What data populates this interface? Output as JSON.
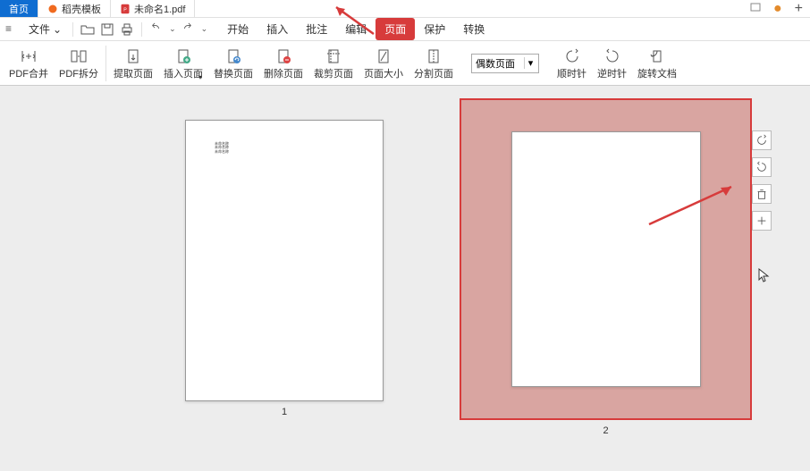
{
  "tabs": {
    "home": "首页",
    "template": "稻壳模板",
    "doc": "未命名1.pdf"
  },
  "menu": {
    "menuBtn": "≡",
    "fileLabel": "文件",
    "chevron": "⌄",
    "items": [
      "开始",
      "插入",
      "批注",
      "编辑",
      "页面",
      "保护",
      "转换"
    ],
    "activeIndex": 4
  },
  "ribbon": {
    "pdfMerge": "PDF合并",
    "pdfSplit": "PDF拆分",
    "extract": "提取页面",
    "insert": "插入页面",
    "replace": "替换页面",
    "delete": "删除页面",
    "crop": "裁剪页面",
    "size": "页面大小",
    "split": "分割页面",
    "dropdown": "偶数页面",
    "cw": "顺时针",
    "ccw": "逆时针",
    "rotate": "旋转文档"
  },
  "pages": {
    "p1num": "1",
    "p2num": "2",
    "p1text": "未命名称\n未命名称\n未命名称"
  },
  "colors": {
    "accent": "#d73b3b",
    "tabActive": "#0f6dd1",
    "selBg": "#d9a5a1"
  }
}
